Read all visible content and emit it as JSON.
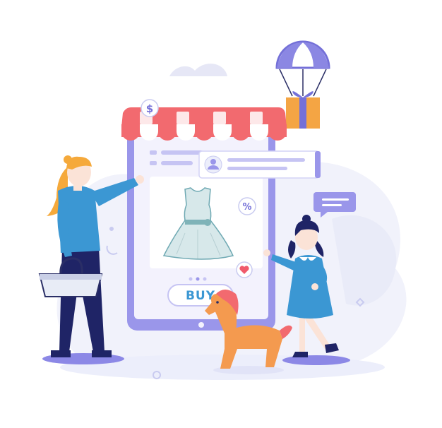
{
  "scene": {
    "buy_button": {
      "label": "BUY"
    },
    "currency_badge": {
      "symbol": "$"
    },
    "discount_badge": {
      "symbol": "%"
    }
  },
  "colors": {
    "phone_frame": "#9a96ea",
    "phone_screen": "#f3f2fd",
    "awning_red": "#f26a6f",
    "awning_white": "#ffffff",
    "dress": "#d7e8ea",
    "primary_blue": "#3b97d3",
    "navy": "#2a2e66",
    "hair_orange": "#f5a93b",
    "horse_orange": "#f49a4f",
    "gift_orange": "#f4a544",
    "parachute_purple": "#7470d8",
    "heart_red": "#f05a6b",
    "blob_lavender": "#eef0fb"
  },
  "icons": [
    "dollar-icon",
    "percent-icon",
    "heart-icon",
    "user-avatar-icon",
    "chat-bubble-icon",
    "parachute-gift-icon",
    "shopping-basket-icon"
  ]
}
